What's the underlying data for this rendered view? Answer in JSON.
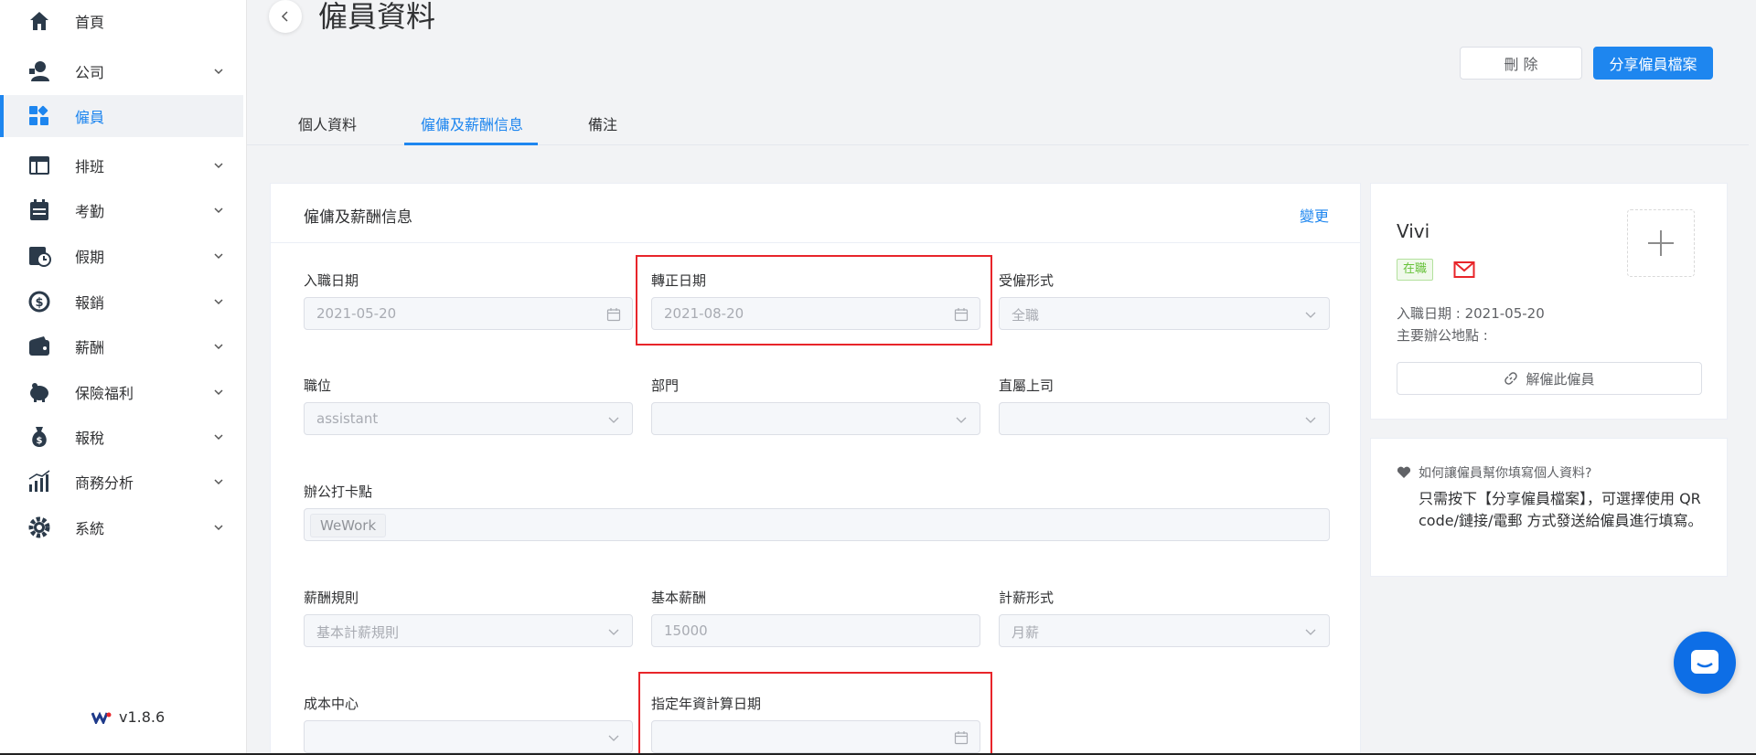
{
  "sidebar": {
    "items": [
      {
        "label": "首頁",
        "icon": "home-icon",
        "has_children": false
      },
      {
        "label": "公司",
        "icon": "company-icon",
        "has_children": true
      },
      {
        "label": "僱員",
        "icon": "employees-icon",
        "has_children": false,
        "active": true
      },
      {
        "label": "排班",
        "icon": "schedule-icon",
        "has_children": true
      },
      {
        "label": "考勤",
        "icon": "attendance-icon",
        "has_children": true
      },
      {
        "label": "假期",
        "icon": "leave-icon",
        "has_children": true
      },
      {
        "label": "報銷",
        "icon": "reimbursement-icon",
        "has_children": true
      },
      {
        "label": "薪酬",
        "icon": "wallet-icon",
        "has_children": true
      },
      {
        "label": "保險福利",
        "icon": "piggy-bank-icon",
        "has_children": true
      },
      {
        "label": "報稅",
        "icon": "money-bag-icon",
        "has_children": true
      },
      {
        "label": "商務分析",
        "icon": "analytics-icon",
        "has_children": true
      },
      {
        "label": "系統",
        "icon": "settings-icon",
        "has_children": true
      }
    ],
    "version": "v1.8.6"
  },
  "header": {
    "title": "僱員資料",
    "delete_label": "刪 除",
    "share_label": "分享僱員檔案"
  },
  "tabs": [
    {
      "label": "個人資料"
    },
    {
      "label": "僱傭及薪酬信息",
      "active": true
    },
    {
      "label": "備注"
    }
  ],
  "employment": {
    "title": "僱傭及薪酬信息",
    "edit_label": "變更",
    "fields": {
      "join_date": {
        "label": "入職日期",
        "value": "2021-05-20"
      },
      "confirm_date": {
        "label": "轉正日期",
        "value": "2021-08-20"
      },
      "employment_type": {
        "label": "受僱形式",
        "value": "全職"
      },
      "position": {
        "label": "職位",
        "value": "assistant"
      },
      "department": {
        "label": "部門",
        "value": ""
      },
      "supervisor": {
        "label": "直屬上司",
        "value": ""
      },
      "clock_location": {
        "label": "辦公打卡點",
        "tag": "WeWork"
      },
      "salary_rule": {
        "label": "薪酬規則",
        "value": "基本計薪規則"
      },
      "base_salary": {
        "label": "基本薪酬",
        "value": "15000"
      },
      "pay_type": {
        "label": "計薪形式",
        "value": "月薪"
      },
      "cost_center": {
        "label": "成本中心",
        "value": ""
      },
      "seniority_date": {
        "label": "指定年資計算日期",
        "value": ""
      }
    }
  },
  "profile": {
    "name": "Vivi",
    "status": "在職",
    "join_date_line": "入職日期 : 2021-05-20",
    "office_line": "主要辦公地點 :",
    "dismiss_label": "解僱此僱員"
  },
  "help": {
    "question": "如何讓僱員幫你填寫個人資料?",
    "answer": "只需按下【分享僱員檔案】，可選擇使用 QR code/鏈接/電郵 方式發送給僱員進行填寫。"
  },
  "colors": {
    "primary": "#1e86ef",
    "highlight": "#e8252a",
    "status_green": "#67c23a"
  }
}
